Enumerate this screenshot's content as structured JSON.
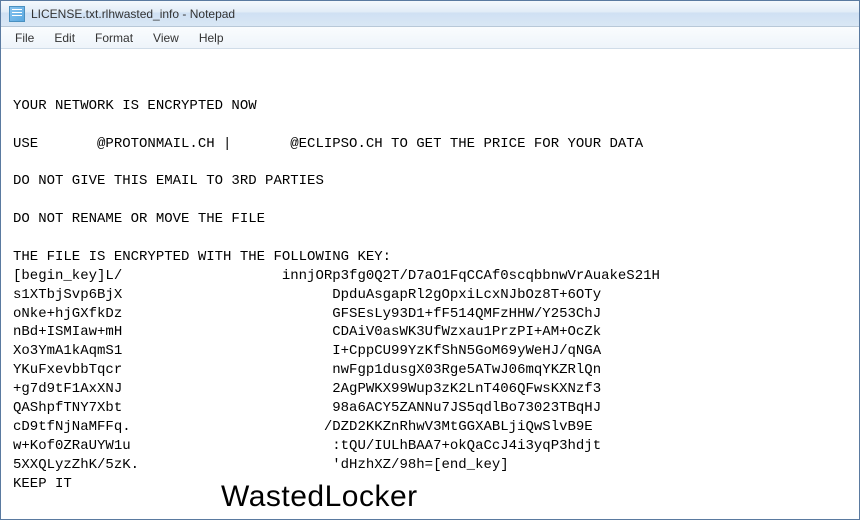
{
  "window": {
    "title": "LICENSE.txt.rlhwasted_info - Notepad"
  },
  "menu": {
    "file": "File",
    "edit": "Edit",
    "format": "Format",
    "view": "View",
    "help": "Help"
  },
  "content": {
    "body": "\nYOUR NETWORK IS ENCRYPTED NOW\n\nUSE       @PROTONMAIL.CH |       @ECLIPSO.CH TO GET THE PRICE FOR YOUR DATA\n\nDO NOT GIVE THIS EMAIL TO 3RD PARTIES\n\nDO NOT RENAME OR MOVE THE FILE\n\nTHE FILE IS ENCRYPTED WITH THE FOLLOWING KEY:\n[begin_key]L/                   innjORp3fg0Q2T/D7aO1FqCCAf0scqbbnwVrAuakeS21H\ns1XTbjSvp6BjX                         DpduAsgapRl2gOpxiLcxNJbOz8T+6OTy\noNke+hjGXfkDz                         GFSEsLy93D1+fF514QMFzHHW/Y253ChJ\nnBd+ISMIaw+mH                         CDAiV0asWK3UfWzxau1PrzPI+AM+OcZk\nXo3YmA1kAqmS1                         I+CppCU99YzKfShN5GoM69yWeHJ/qNGA\nYKuFxevbbTqcr                         nwFgp1dusgX03Rge5ATwJ06mqYKZRlQn\n+g7d9tF1AxXNJ                         2AgPWKX99Wup3zK2LnT406QFwsKXNzf3\nQAShpfTNY7Xbt                         98a6ACY5ZANNu7JS5qdlBo73023TBqHJ\ncD9tfNjNaMFFq.                       /DZD2KKZnRhwV3MtGGXABLjiQwSlvB9E\nw+Kof0ZRaUYW1u                        :tQU/IULhBAA7+okQaCcJ4i3yqP3hdjt\n5XXQLyzZhK/5zK.                       'dHzhXZ/98h=[end_key]\nKEEP IT"
  },
  "watermark": {
    "text": "WastedLocker"
  }
}
